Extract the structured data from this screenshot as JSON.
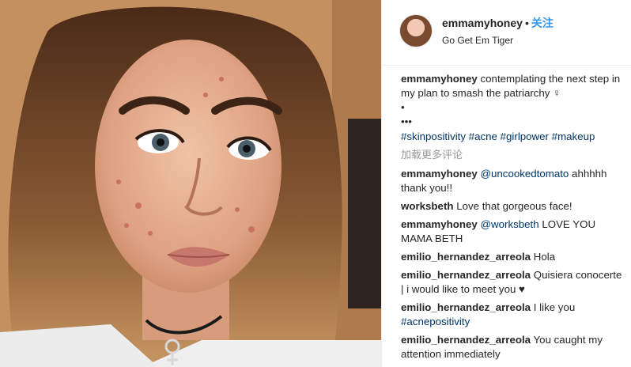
{
  "header": {
    "username": "emmamyhoney",
    "separator": "•",
    "follow_label": "关注",
    "location": "Go Get Em Tiger"
  },
  "caption": {
    "username": "emmamyhoney",
    "text": "contemplating the next step in my plan to smash the patriarchy ♀",
    "dot_line": "•",
    "ellipsis_line": "•••",
    "hashtags": "#skinpositivity #acne #girlpower #makeup"
  },
  "load_more_label": "加载更多评论",
  "comments": [
    {
      "username": "emmamyhoney",
      "mention": "@uncookedtomato",
      "text": "ahhhhh thank you!!"
    },
    {
      "username": "worksbeth",
      "mention": "",
      "text": "Love that gorgeous face!"
    },
    {
      "username": "emmamyhoney",
      "mention": "@worksbeth",
      "text": "LOVE YOU MAMA BETH"
    },
    {
      "username": "emilio_hernandez_arreola",
      "mention": "",
      "text": "Hola"
    },
    {
      "username": "emilio_hernandez_arreola",
      "mention": "",
      "text": "Quisiera conocerte | i would like to meet you ♥"
    },
    {
      "username": "emilio_hernandez_arreola",
      "mention": "",
      "text": "I like you",
      "hashtag": "#acnepositivity"
    },
    {
      "username": "emilio_hernandez_arreola",
      "mention": "",
      "text": "You caught my attention immediately"
    }
  ],
  "colors": {
    "link": "#003569",
    "follow": "#3897f0",
    "muted": "#999999"
  }
}
